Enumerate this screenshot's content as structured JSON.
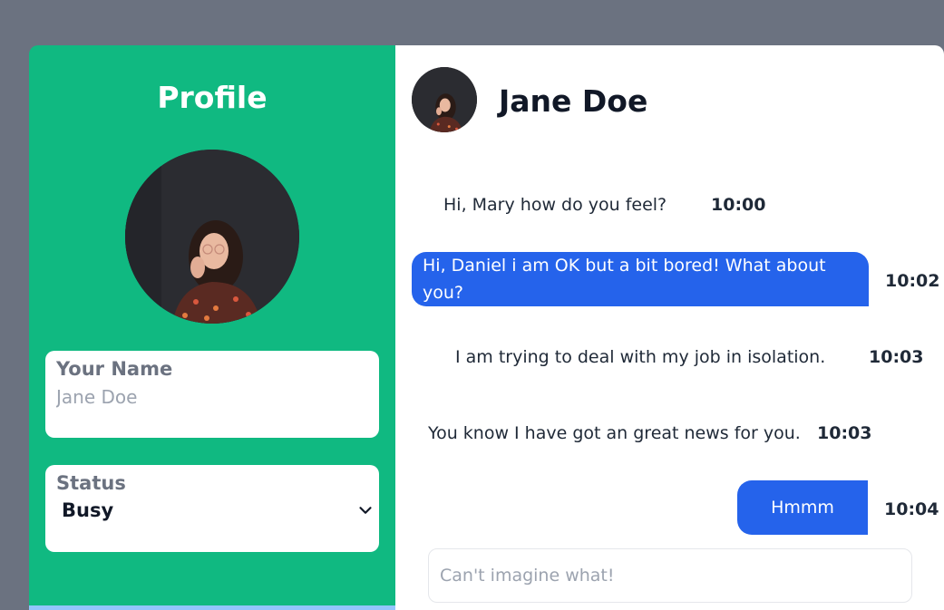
{
  "profile": {
    "title": "Profile",
    "name_label": "Your Name",
    "name_placeholder": "Jane Doe",
    "status_label": "Status",
    "status_value": "Busy"
  },
  "chat": {
    "contact_name": "Jane Doe",
    "messages": [
      {
        "text": "Hi, Mary how do you feel?",
        "time": "10:00",
        "sent": false
      },
      {
        "text": "Hi, Daniel i am OK but a bit bored! What about you?",
        "time": "10:02",
        "sent": true
      },
      {
        "text": "I am trying to deal with my job in isolation.",
        "time": "10:03",
        "sent": false
      },
      {
        "text": "You know I have got an great news for you.",
        "time": "10:03",
        "sent": false
      },
      {
        "text": "Hmmm",
        "time": "10:04",
        "sent": true
      }
    ],
    "compose_placeholder": "Can't imagine what!"
  },
  "colors": {
    "profile_bg": "#10b981",
    "sent_bubble": "#2563eb",
    "page_bg": "#6b7280"
  },
  "icons": [
    "chevron-down-icon",
    "avatar"
  ]
}
